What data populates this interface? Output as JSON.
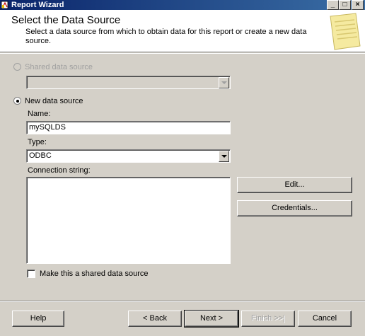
{
  "window": {
    "title": "Report Wizard",
    "minimize": "_",
    "maximize": "□",
    "close": "×"
  },
  "header": {
    "title": "Select the Data Source",
    "description": "Select a data source from which to obtain data for this report or create a new data source."
  },
  "shared_source": {
    "label": "Shared data source",
    "enabled": false,
    "selected": false,
    "value": ""
  },
  "new_source": {
    "label": "New data source",
    "selected": true,
    "name_label": "Name:",
    "name_value": "mySQLDS",
    "type_label": "Type:",
    "type_value": "ODBC",
    "connection_label": "Connection string:",
    "connection_value": "",
    "edit_label": "Edit...",
    "credentials_label": "Credentials...",
    "shared_checkbox_label": "Make this a shared data source",
    "shared_checked": false
  },
  "footer": {
    "help": "Help",
    "back": "< Back",
    "next": "Next >",
    "finish": "Finish >>|",
    "cancel": "Cancel"
  }
}
